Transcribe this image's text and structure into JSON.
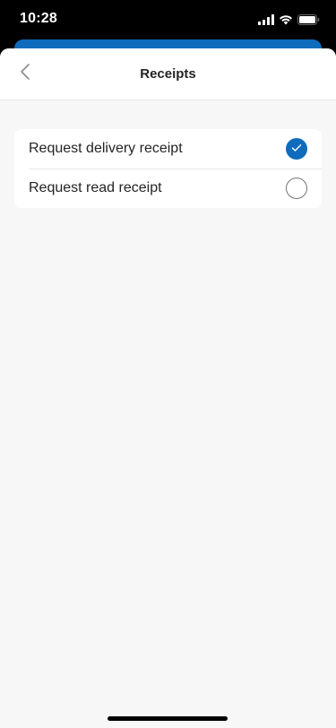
{
  "status_bar": {
    "time": "10:28",
    "icons": [
      "signal-icon",
      "wifi-icon",
      "battery-icon"
    ]
  },
  "nav": {
    "title": "Receipts",
    "back_icon": "chevron-left-icon"
  },
  "receipts": {
    "items": [
      {
        "label": "Request delivery receipt",
        "checked": true
      },
      {
        "label": "Request read receipt",
        "checked": false
      }
    ]
  },
  "colors": {
    "accent": "#0f6cbd",
    "background": "#f7f7f7",
    "card": "#ffffff",
    "text": "#242424"
  }
}
